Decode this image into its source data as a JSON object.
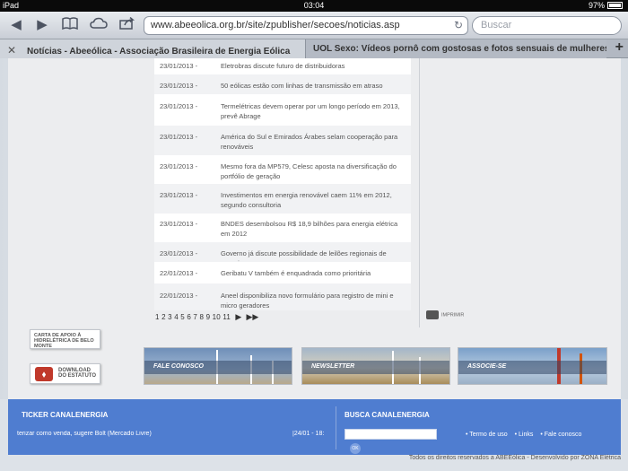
{
  "status_bar": {
    "device": "iPad",
    "time": "03:04",
    "battery": "97%"
  },
  "browser": {
    "url": "www.abeeolica.org.br/site/zpublisher/secoes/noticias.asp",
    "search_placeholder": "Buscar"
  },
  "tabs": [
    {
      "label": "Notícias - Abeeólica - Associação Brasileira de Energia Eólica"
    },
    {
      "label": "UOL Sexo: Vídeos pornô com gostosas e fotos sensuais de mulheres nu..."
    }
  ],
  "news": [
    {
      "date": "23/01/2013 -",
      "title": "Eletrobras discute futuro de distribuidoras"
    },
    {
      "date": "23/01/2013 -",
      "title": "50 eólicas estão com linhas de transmissão em atraso"
    },
    {
      "date": "23/01/2013 -",
      "title": "Termelétricas devem operar por um longo período em 2013, prevê Abrage"
    },
    {
      "date": "23/01/2013 -",
      "title": "América do Sul e Emirados Árabes selam cooperação para renováveis"
    },
    {
      "date": "23/01/2013 -",
      "title": "Mesmo fora da MP579, Celesc aposta na diversificação do portfólio de geração"
    },
    {
      "date": "23/01/2013 -",
      "title": "Investimentos em energia renovável caem 11% em 2012, segundo consultoria"
    },
    {
      "date": "23/01/2013 -",
      "title": "BNDES desembolsou R$ 18,9 bilhões para energia elétrica em 2012"
    },
    {
      "date": "23/01/2013 -",
      "title": "Governo já discute possibilidade de leilões regionais de energia"
    },
    {
      "date": "22/01/2013 -",
      "title": "Geribatu V também é enquadrada como prioritária"
    },
    {
      "date": "22/01/2013 -",
      "title": "Aneel disponibiliza novo formulário para registro de mini e micro geradores"
    }
  ],
  "pager": {
    "pages": "1 2 3 4 5 6 7 8 9 10 11"
  },
  "print_label": "IMPRIMIR",
  "side_buttons": {
    "carta": "CARTA DE APOIO À HIDRELÉTRICA DE BELO MONTE",
    "download": "DOWNLOAD DO ESTATUTO"
  },
  "banners": [
    "FALE CONOSCO",
    "NEWSLETTER",
    "ASSOCIE-SE"
  ],
  "footer": {
    "ticker_title": "TICKER CANALENERGIA",
    "ticker_text": "terizar como venda, sugere Bolt (Mercado Livre)",
    "ticker_date": "|24/01 - 18:",
    "busca_title": "BUSCA CANALENERGIA",
    "busca_ok": "OK",
    "links": [
      "• Termo de uso",
      "• Links",
      "• Fale conosco"
    ],
    "copyright": "Todos os direitos reservados a ABEEólica - Desenvolvido por ZONA Elétrica"
  }
}
